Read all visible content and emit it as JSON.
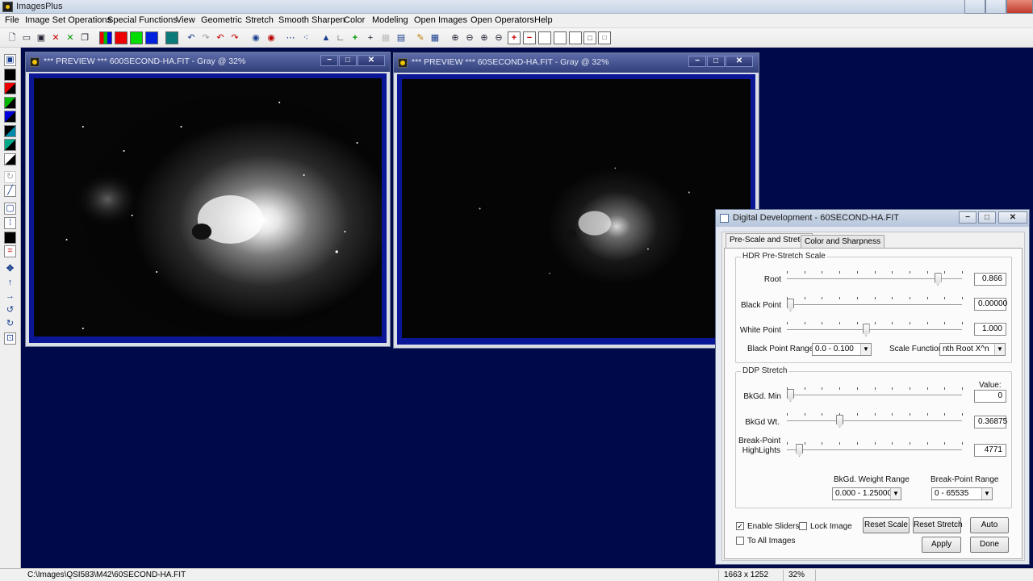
{
  "app": {
    "title": "ImagesPlus"
  },
  "menu": [
    "File",
    "Image Set Operations",
    "Special Functions",
    "View",
    "Geometric",
    "Stretch",
    "Smooth Sharpen",
    "Color",
    "Modeling",
    "Open Images",
    "Open Operators",
    "Help"
  ],
  "windows": [
    {
      "title": "*** PREVIEW *** 600SECOND-HA.FIT - Gray @ 32%"
    },
    {
      "title": "*** PREVIEW *** 60SECOND-HA.FIT - Gray @ 32%"
    }
  ],
  "dialog": {
    "title": "Digital Development - 60SECOND-HA.FIT",
    "tabs": [
      "Pre-Scale and Stretch",
      "Color and Sharpness"
    ],
    "hdr": {
      "group": "HDR Pre-Stretch Scale",
      "root": {
        "label": "Root",
        "value": "0.866",
        "pos": 0.86
      },
      "black_point": {
        "label": "Black Point",
        "value": "0.00000",
        "pos": 0.0
      },
      "white_point": {
        "label": "White Point",
        "value": "1.000",
        "pos": 0.45
      },
      "bp_range_label": "Black Point Range",
      "bp_range_value": "0.0 - 0.100",
      "scale_fn_label": "Scale Function",
      "scale_fn_value": "nth Root X^n"
    },
    "ddp": {
      "group": "DDP Stretch",
      "value_header": "Value:",
      "bkgd_min": {
        "label": "BkGd. Min",
        "value": "0",
        "pos": 0.0
      },
      "bkgd_wt": {
        "label": "BkGd Wt.",
        "value": "0.36875",
        "pos": 0.3
      },
      "breakpoint": {
        "label1": "Break-Point",
        "label2": "HighLights",
        "value": "4771",
        "pos": 0.07
      },
      "weight_range_label": "BkGd. Weight Range",
      "weight_range_value": "0.000 - 1.25000",
      "bp_range_label": "Break-Point Range",
      "bp_range_value": "0 - 65535"
    },
    "options": {
      "enable_sliders": "Enable Sliders",
      "lock_image": "Lock Image",
      "to_all_images": "To All Images"
    },
    "buttons": {
      "reset_scale": "Reset Scale",
      "reset_stretch": "Reset Stretch",
      "auto": "Auto",
      "apply": "Apply",
      "done": "Done"
    }
  },
  "status": {
    "path": "C:\\Images\\QSI583\\M42\\60SECOND-HA.FIT",
    "dimensions": "1663 x 1252",
    "zoom": "32%"
  }
}
